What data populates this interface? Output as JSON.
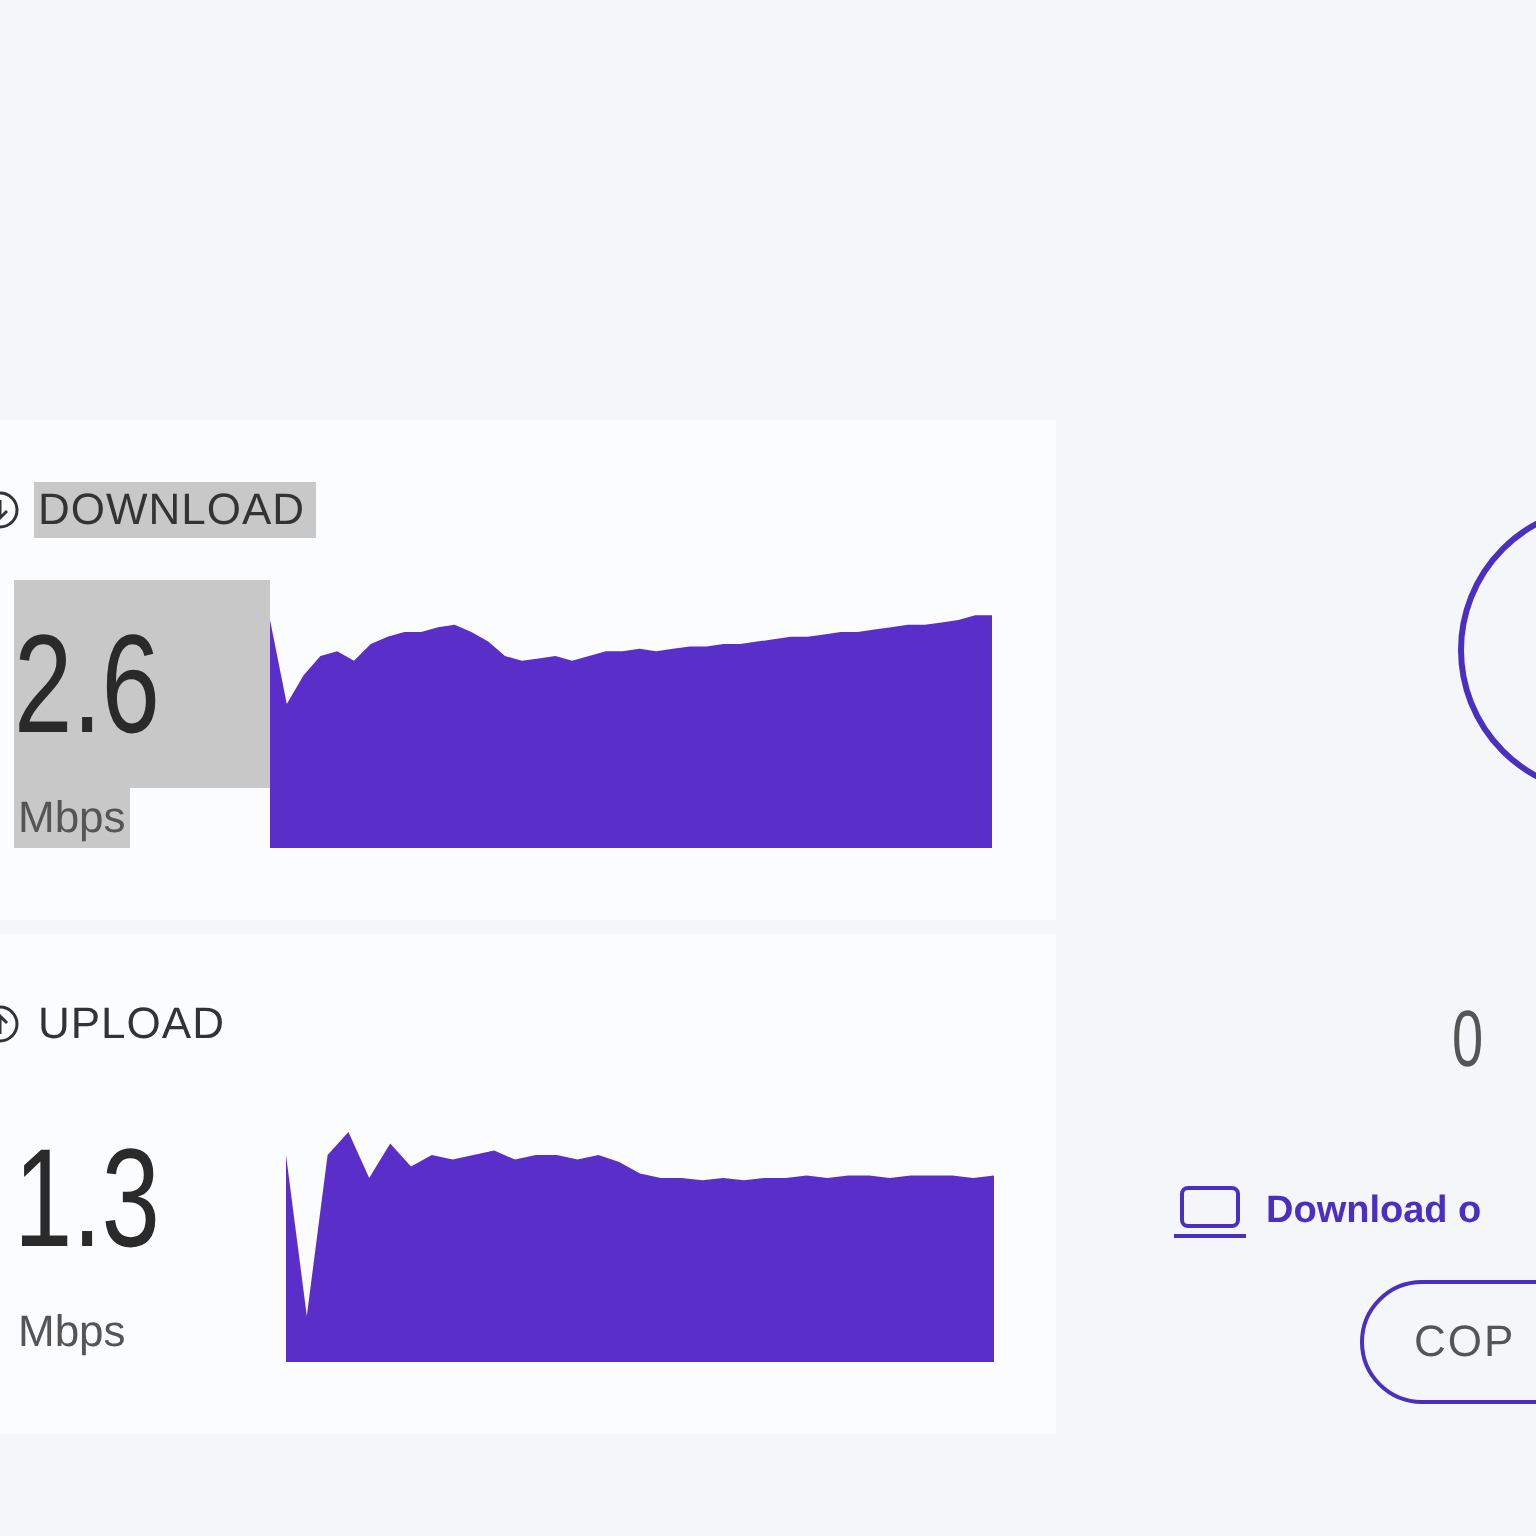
{
  "results": [
    {
      "kind": "download",
      "label": "DOWNLOAD",
      "value": "2.6",
      "unit": "Mbps",
      "highlighted": true
    },
    {
      "kind": "upload",
      "label": "UPLOAD",
      "value": "1.3",
      "unit": "Mbps",
      "highlighted": false
    }
  ],
  "gauge": {
    "reading": "0"
  },
  "app_link": {
    "label": "Download o"
  },
  "copy_button": {
    "label": "COP"
  }
}
